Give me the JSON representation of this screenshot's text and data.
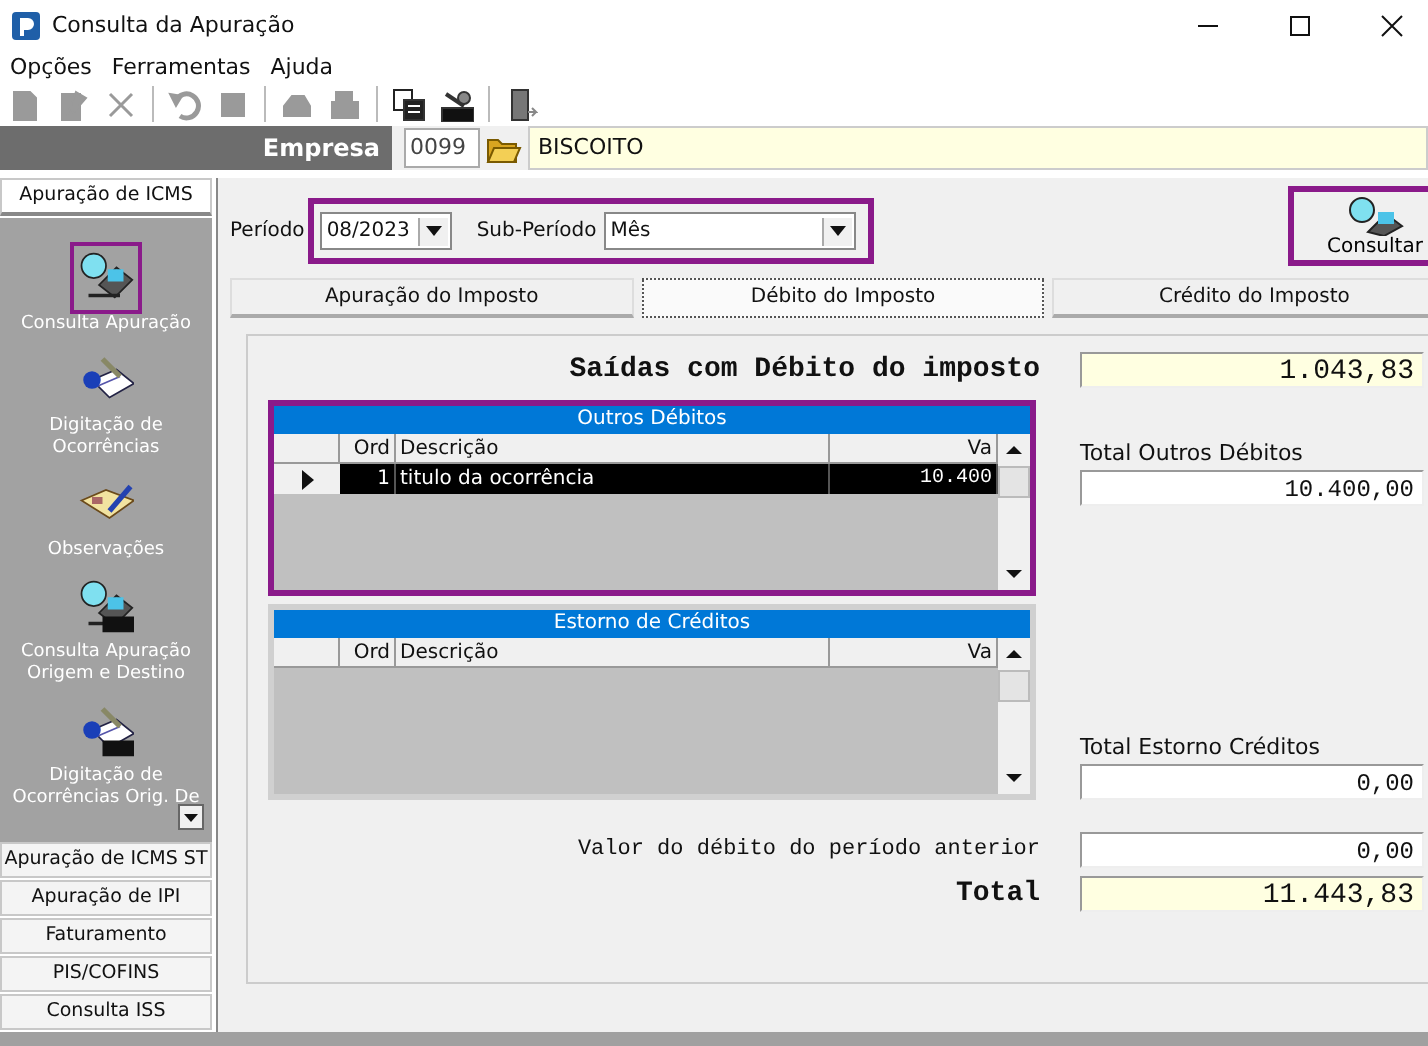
{
  "window": {
    "title": "Consulta da Apuração"
  },
  "menu": [
    "Opções",
    "Ferramentas",
    "Ajuda"
  ],
  "toolbar": [
    {
      "kind": "page",
      "disabled": true
    },
    {
      "kind": "edit",
      "disabled": true
    },
    {
      "kind": "delete",
      "disabled": true
    },
    {
      "kind": "sep"
    },
    {
      "kind": "undo",
      "disabled": true
    },
    {
      "kind": "stop",
      "disabled": true
    },
    {
      "kind": "sep"
    },
    {
      "kind": "print",
      "disabled": true
    },
    {
      "kind": "printer",
      "disabled": true
    },
    {
      "kind": "sep"
    },
    {
      "kind": "report",
      "disabled": false
    },
    {
      "kind": "report-difal",
      "disabled": false
    },
    {
      "kind": "sep"
    },
    {
      "kind": "exit",
      "disabled": false
    }
  ],
  "company": {
    "label": "Empresa",
    "code": "0099",
    "name": "BISCOITO"
  },
  "sidebar": {
    "sections": [
      {
        "label": "Apuração de ICMS",
        "expanded": true,
        "items": [
          {
            "kind": "query",
            "label": "Consulta Apuração",
            "highlighted": true
          },
          {
            "kind": "entry",
            "label": "Digitação de Ocorrências",
            "highlighted": false
          },
          {
            "kind": "notes",
            "label": "Observações",
            "highlighted": false
          },
          {
            "kind": "query-difal",
            "label": "Consulta Apuração Origem e Destino",
            "highlighted": false
          },
          {
            "kind": "entry-difal",
            "label": "Digitação de Ocorrências Orig. De",
            "highlighted": false
          }
        ]
      },
      {
        "label": "Apuração de ICMS ST",
        "expanded": false
      },
      {
        "label": "Apuração de IPI",
        "expanded": false
      },
      {
        "label": "Faturamento",
        "expanded": false
      },
      {
        "label": "PIS/COFINS",
        "expanded": false
      },
      {
        "label": "Consulta ISS",
        "expanded": false
      }
    ]
  },
  "filter": {
    "highlighted": true,
    "period_label": "Período",
    "period": "08/2023",
    "sub_period_label": "Sub-Período",
    "sub_period": "Mês"
  },
  "consult_button": {
    "label": "Consultar",
    "highlighted": true
  },
  "tabs": [
    {
      "label": "Apuração do Imposto",
      "selected": false
    },
    {
      "label": "Débito do Imposto",
      "selected": true
    },
    {
      "label": "Crédito do Imposto",
      "selected": false
    }
  ],
  "debit": {
    "label": "Saídas com Débito do imposto",
    "value": "1.043,83"
  },
  "grids": [
    {
      "title": "Outros Débitos",
      "highlighted": true,
      "columns": [
        "Ord",
        "Descrição",
        "Va"
      ],
      "rows": [
        {
          "ord": "1",
          "description": "titulo da ocorrência",
          "value": "10.400",
          "selected": true
        }
      ],
      "total_label": "Total Outros Débitos",
      "total": "10.400,00"
    },
    {
      "title": "Estorno de Créditos",
      "highlighted": false,
      "columns": [
        "Ord",
        "Descrição",
        "Va"
      ],
      "total_label": "Total Estorno Créditos",
      "total": "0,00"
    }
  ],
  "previous": {
    "label": "Valor do débito do período anterior",
    "value": "0,00"
  },
  "total": {
    "label": "Total",
    "value": "11.443,83"
  }
}
